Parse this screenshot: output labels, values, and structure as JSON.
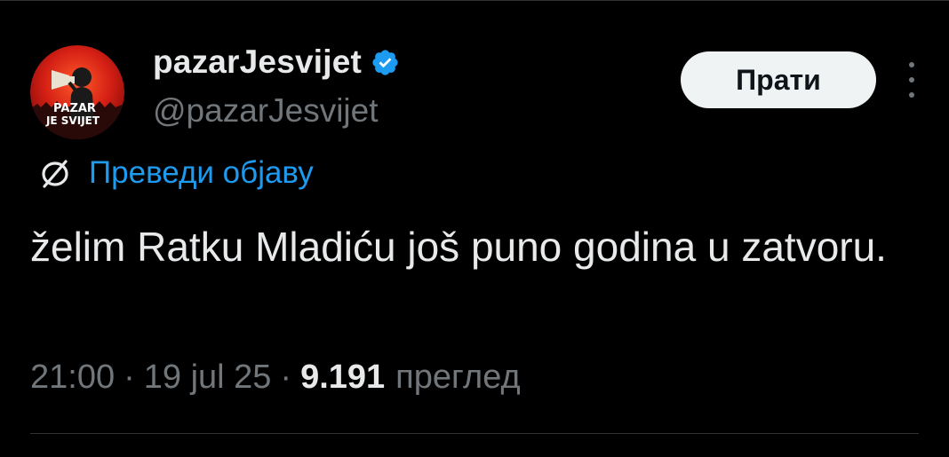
{
  "account": {
    "display_name": "pazarJesvijet",
    "handle": "@pazarJesvijet",
    "verified": true,
    "verified_color": "#1d9bf0",
    "avatar": {
      "description_icon": "megaphone-person-avatar",
      "text_line1": "PAZAR",
      "text_line2": "JE SVIJET"
    }
  },
  "actions": {
    "follow_label": "Прати",
    "more_icon": "more-vertical-icon"
  },
  "translate": {
    "label": "Преведи објаву",
    "icon": "translate-icon"
  },
  "tweet": {
    "text": "želim Ratku Mladiću još puno godina u zatvoru."
  },
  "meta": {
    "time": "21:00",
    "separator": "·",
    "date": "19 jul 25",
    "views_count": "9.191",
    "views_label": "преглед"
  },
  "colors": {
    "background": "#000000",
    "text_primary": "#e7e9ea",
    "text_secondary": "#71767b",
    "link": "#1d9bf0",
    "button_bg": "#eff3f4"
  }
}
